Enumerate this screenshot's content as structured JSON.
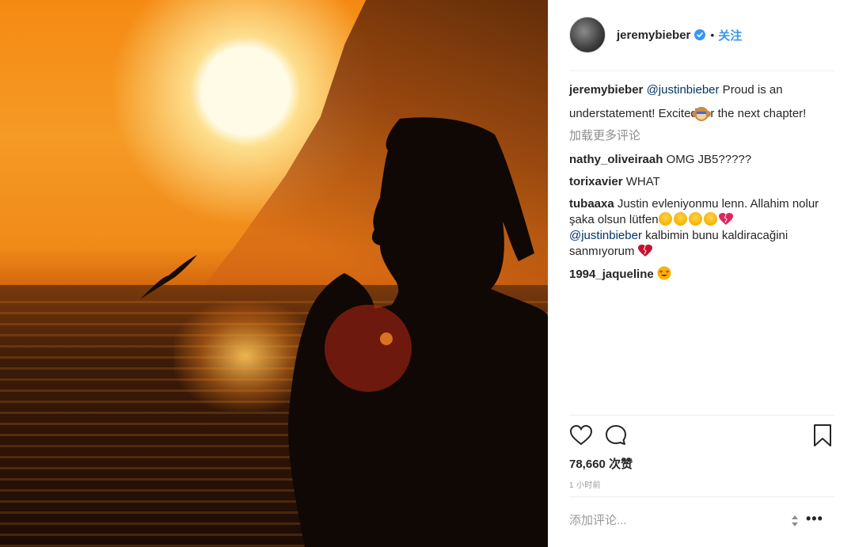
{
  "header": {
    "username": "jeremybieber",
    "separator": "•",
    "follow_label": "关注"
  },
  "caption": {
    "username": "jeremybieber",
    "mention": "@justinbieber",
    "text": " Proud is an understatement! Excited for the next chapter!"
  },
  "load_more_label": "加载更多评论",
  "comments": [
    {
      "username": "nathy_oliveiraah",
      "text": " OMG JB5?????"
    },
    {
      "username": "torixavier",
      "text": " WHAT"
    },
    {
      "username": "tubaaxa",
      "text": " Justin evleniyonmu lenn. Allahim nolur şaka olsun lütfen",
      "mention": "@justinbieber",
      "text2": " kalbimin bunu kaldiracağini sanmıyorum"
    },
    {
      "username": "1994_jaqueline",
      "text": " "
    }
  ],
  "likes": {
    "count": "78,660",
    "label": "次赞"
  },
  "timestamp": "1 小时前",
  "comment_input": {
    "placeholder": "添加评论..."
  },
  "more_label": "•••",
  "colors": {
    "link": "#3897f0",
    "mention": "#003569",
    "text": "#262626",
    "muted": "#8e8e8e"
  },
  "icons": [
    "verified-badge-icon",
    "heart-icon",
    "comment-icon",
    "bookmark-icon",
    "more-icon"
  ]
}
